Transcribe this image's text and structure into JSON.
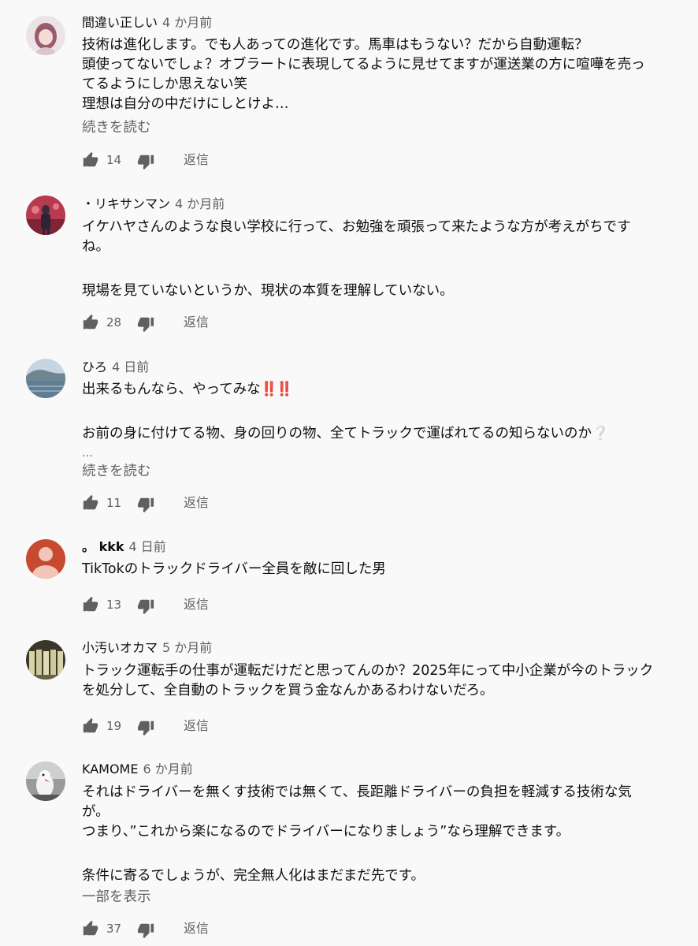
{
  "comments": [
    {
      "author": "間違い正しい",
      "time": "4 か月前",
      "lines": [
        "技術は進化します。でも人あっての進化です。馬車はもうない？だから自動運転？",
        "頭使ってないでしょ？オブラートに表現してるように見せてますが運送業の方に喧嘩を売っ",
        "てるようにしか思えない笑",
        "理想は自分の中だけにしとけよ…"
      ],
      "more": "続きを読む",
      "likes": "14",
      "reply": "返信"
    },
    {
      "author": "・リキサンマン",
      "time": "4 か月前",
      "lines": [
        "イケハヤさんのような良い学校に行って、お勉強を頑張って来たような方が考えがちです",
        "ね。",
        "",
        "現場を見ていないというか、現状の本質を理解していない。"
      ],
      "likes": "28",
      "reply": "返信"
    },
    {
      "author": "ひろ",
      "time": "4 日前",
      "line1": "出来るもんなら、やってみな",
      "line1_emoji": "‼️‼️",
      "line3": "お前の身に付けてる物、身の回りの物、全てトラックで運ばれてるの知らないのか",
      "line3_emoji": "❔",
      "ellipsis": "…",
      "more": "続きを読む",
      "likes": "11",
      "reply": "返信"
    },
    {
      "author": "。 kkk",
      "time": "4 日前",
      "lines": [
        "TikTokのトラックドライバー全員を敵に回した男"
      ],
      "likes": "13",
      "reply": "返信"
    },
    {
      "author": "小汚いオカマ",
      "time": "5 か月前",
      "lines": [
        "トラック運転手の仕事が運転だけだと思ってんのか？2025年にって中小企業が今のトラック",
        "を処分して、全自動のトラックを買う金なんかあるわけないだろ。"
      ],
      "likes": "19",
      "reply": "返信"
    },
    {
      "author": "KAMOME",
      "time": "6 か月前",
      "lines": [
        "それはドライバーを無くす技術では無くて、長距離ドライバーの負担を軽減する技術な気",
        "が。",
        "つまり、”これから楽になるのでドライバーになりましょう”なら理解できます。",
        "",
        "条件に寄るでしょうが、完全無人化はまだまだ先です。"
      ],
      "more": "一部を表示",
      "likes": "37",
      "reply": "返信"
    }
  ],
  "colors": {
    "background": "#f9f9f9",
    "text": "#0f0f0f",
    "secondary": "#606060",
    "default_avatar": "#c84a2e"
  },
  "icons": {
    "like": "thumb-up-icon",
    "dislike": "thumb-down-icon"
  }
}
